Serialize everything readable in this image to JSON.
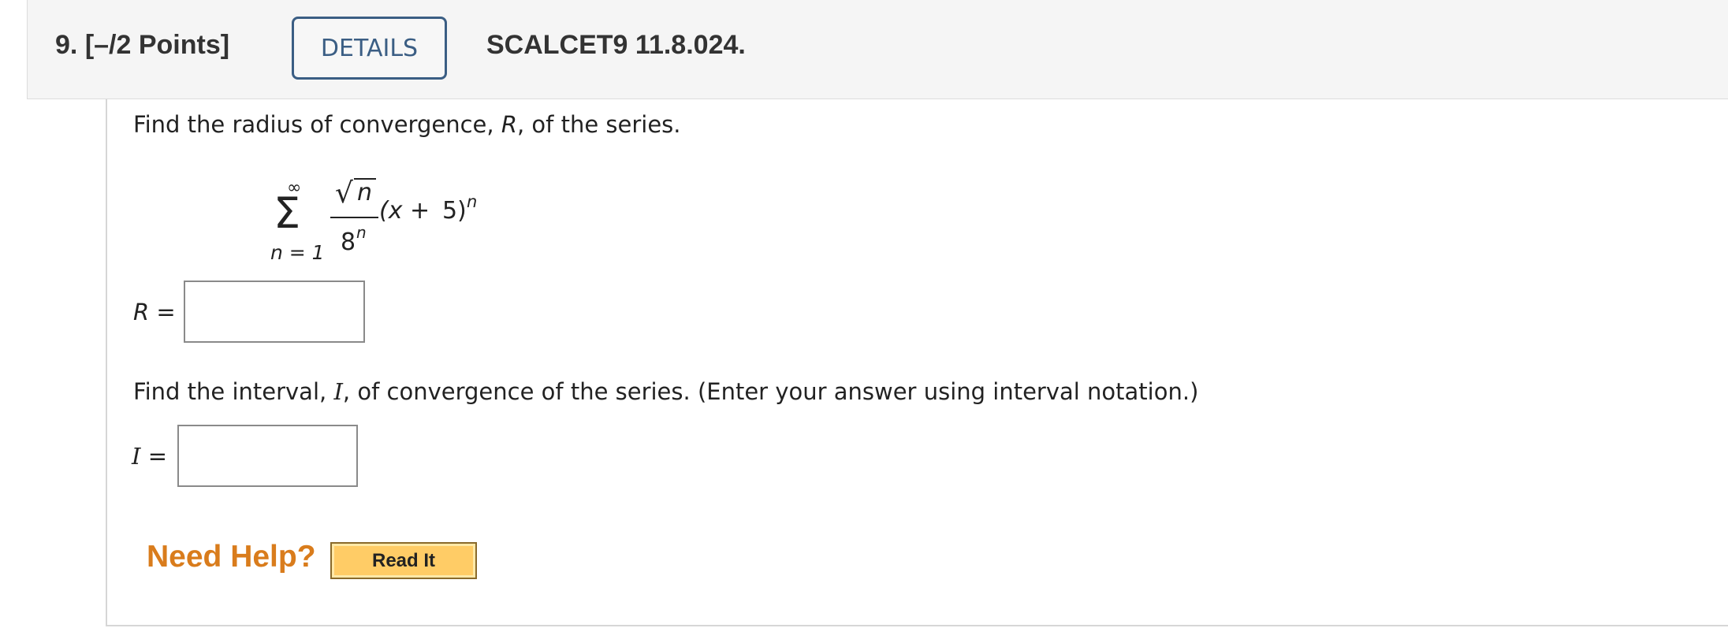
{
  "question": {
    "number": "9.",
    "points": "[–/2 Points]",
    "details_label": "DETAILS",
    "code": "SCALCET9 11.8.024."
  },
  "part1": {
    "prompt_pre": "Find the radius of convergence, ",
    "prompt_var": "R",
    "prompt_post": ", of the series.",
    "answer_label_var": "R",
    "answer_label_eq": "=",
    "answer_value": ""
  },
  "series": {
    "upper": "∞",
    "sigma": "Σ",
    "lower": "n = 1",
    "radical": "√",
    "numerator_var": "n",
    "denominator_base": "8",
    "denominator_exp": "n",
    "factor_open": "(x + ",
    "factor_const": "5",
    "factor_close": ")",
    "factor_exp": "n"
  },
  "part2": {
    "prompt_pre": "Find the interval, ",
    "prompt_var": "I",
    "prompt_post": ", of convergence of the series. (Enter your answer using interval notation.)",
    "answer_label_var": "I",
    "answer_label_eq": "=",
    "answer_value": ""
  },
  "help": {
    "label": "Need Help?",
    "read_it": "Read It"
  },
  "colors": {
    "accent_blue": "#3b5e84",
    "highlight_red": "#c0392b",
    "help_orange": "#d97c1c",
    "button_yellow": "#ffcc66"
  }
}
